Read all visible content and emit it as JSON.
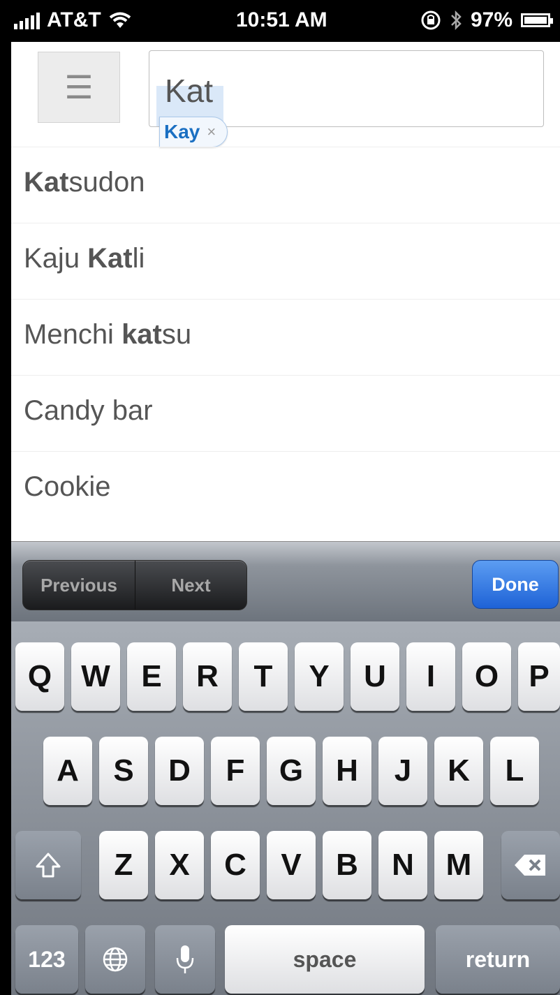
{
  "status_bar": {
    "carrier": "AT&T",
    "time": "10:51 AM",
    "battery": "97%"
  },
  "search": {
    "value": "Kat",
    "tag_label": "Kay",
    "tag_close": "×"
  },
  "suggestions": [
    {
      "pre": "",
      "bold": "Kat",
      "post": "sudon"
    },
    {
      "pre": "Kaju ",
      "bold": "Kat",
      "post": "li"
    },
    {
      "pre": "Menchi ",
      "bold": "kat",
      "post": "su"
    },
    {
      "pre": "Candy bar",
      "bold": "",
      "post": ""
    },
    {
      "pre": "Cookie",
      "bold": "",
      "post": ""
    }
  ],
  "accessory": {
    "previous": "Previous",
    "next": "Next",
    "done": "Done"
  },
  "keyboard": {
    "row1": [
      "Q",
      "W",
      "E",
      "R",
      "T",
      "Y",
      "U",
      "I",
      "O",
      "P"
    ],
    "row2": [
      "A",
      "S",
      "D",
      "F",
      "G",
      "H",
      "J",
      "K",
      "L"
    ],
    "row3": [
      "Z",
      "X",
      "C",
      "V",
      "B",
      "N",
      "M"
    ],
    "numbers": "123",
    "space": "space",
    "return": "return"
  }
}
